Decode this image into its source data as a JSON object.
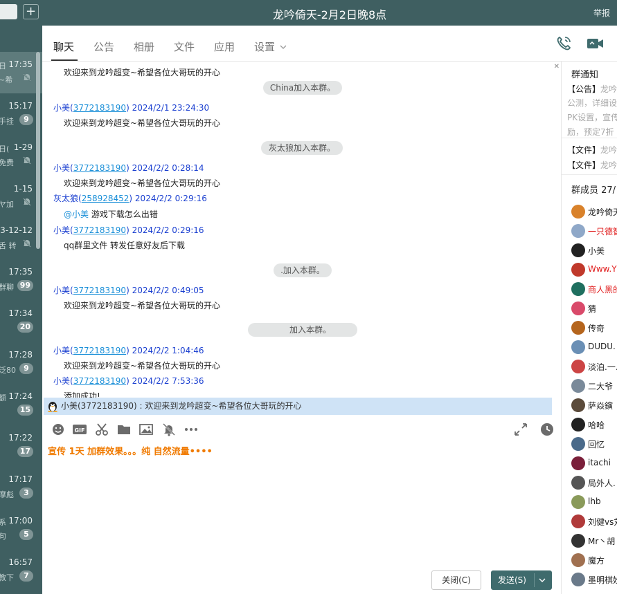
{
  "window": {
    "title": "龙吟倚天-2月2日晚8点",
    "report_label": "举报"
  },
  "sidebar": {
    "plus_label": "+",
    "items": [
      {
        "time": "17:35",
        "preview": "日",
        "preview2": "~希",
        "badge": "",
        "muted": true,
        "active": true
      },
      {
        "time": "15:17",
        "preview": "",
        "preview2": "手挂",
        "badge": "9",
        "muted": false,
        "active": false
      },
      {
        "time": "1-29",
        "preview": "日(",
        "preview2": "免费",
        "badge": "",
        "muted": true,
        "active": false
      },
      {
        "time": "1-15",
        "preview": "",
        "preview2": "ヤ加",
        "badge": "",
        "muted": true,
        "active": false
      },
      {
        "time": "3-12-12",
        "preview": "",
        "preview2": "舌 转",
        "badge": "",
        "muted": true,
        "active": false
      },
      {
        "time": "17:35",
        "preview": "",
        "preview2": "群聊",
        "badge": "99",
        "muted": false,
        "active": false
      },
      {
        "time": "17:34",
        "preview": "",
        "preview2": "",
        "badge": "20",
        "muted": false,
        "active": false
      },
      {
        "time": "17:28",
        "preview": "",
        "preview2": "泛80",
        "badge": "9",
        "muted": false,
        "active": false
      },
      {
        "time": "17:24",
        "preview": "额",
        "preview2": "",
        "badge": "15",
        "muted": false,
        "active": false
      },
      {
        "time": "17:22",
        "preview": "",
        "preview2": "",
        "badge": "17",
        "muted": false,
        "active": false
      },
      {
        "time": "17:17",
        "preview": "",
        "preview2": "摩彪",
        "badge": "3",
        "muted": false,
        "active": false
      },
      {
        "time": "17:00",
        "preview": "系",
        "preview2": "句",
        "badge": "5",
        "muted": false,
        "active": false
      },
      {
        "time": "16:57",
        "preview": "",
        "preview2": "教下",
        "badge": "7",
        "muted": false,
        "active": false
      }
    ]
  },
  "tabs": [
    {
      "label": "聊天",
      "active": true
    },
    {
      "label": "公告",
      "active": false
    },
    {
      "label": "相册",
      "active": false
    },
    {
      "label": "文件",
      "active": false
    },
    {
      "label": "应用",
      "active": false
    },
    {
      "label": "设置",
      "active": false
    }
  ],
  "chat": {
    "messages": [
      {
        "kind": "text",
        "body": "欢迎来到龙吟超变~希望各位大哥玩的开心"
      },
      {
        "kind": "system",
        "text": "China加入本群。"
      },
      {
        "kind": "msg",
        "name": "小美",
        "qq": "3772183190",
        "time": "2024/2/1 23:24:30",
        "body": "欢迎来到龙吟超变~希望各位大哥玩的开心"
      },
      {
        "kind": "system",
        "text": "灰太狼加入本群。"
      },
      {
        "kind": "msg",
        "name": "小美",
        "qq": "3772183190",
        "time": "2024/2/2 0:28:14",
        "body": "欢迎来到龙吟超变~希望各位大哥玩的开心"
      },
      {
        "kind": "msg",
        "name": "灰太狼",
        "qq": "258928452",
        "time": "2024/2/2 0:29:16",
        "at": "@小美",
        "body": "游戏下载怎么出错"
      },
      {
        "kind": "msg",
        "name": "小美",
        "qq": "3772183190",
        "time": "2024/2/2 0:29:16",
        "body": "qq群里文件 转发任意好友后下载"
      },
      {
        "kind": "system",
        "text": ".加入本群。"
      },
      {
        "kind": "msg",
        "name": "小美",
        "qq": "3772183190",
        "time": "2024/2/2 0:49:05",
        "body": "欢迎来到龙吟超变~希望各位大哥玩的开心"
      },
      {
        "kind": "system",
        "text": "加入本群。"
      },
      {
        "kind": "msg",
        "name": "小美",
        "qq": "3772183190",
        "time": "2024/2/2 1:04:46",
        "body": "欢迎来到龙吟超变~希望各位大哥玩的开心"
      },
      {
        "kind": "msg",
        "name": "小美",
        "qq": "3772183190",
        "time": "2024/2/2 7:53:36",
        "body": "添加成功!"
      }
    ],
    "quote": "小美(3772183190) : 欢迎来到龙吟超变~希望各位大哥玩的开心"
  },
  "input": {
    "text": "宣传 1天 加群效果。。。纯 自然流量••••",
    "close_label": "关闭(C)",
    "send_label": "发送(S)"
  },
  "right_panel": {
    "notice_title": "群通知",
    "notices": [
      {
        "tag": "【公告】",
        "text": "龙吟"
      },
      {
        "tag": "",
        "text": "公测，详细设"
      },
      {
        "tag": "",
        "text": "PK设置，宣传"
      },
      {
        "tag": "",
        "text": "励，预定7折"
      },
      {
        "tag": "【文件】",
        "text": "龙吟"
      },
      {
        "tag": "【文件】",
        "text": "龙吟"
      }
    ],
    "members_title": "群成员 27/",
    "members": [
      {
        "name": "龙吟倚天",
        "red": false,
        "color": "#d9822b"
      },
      {
        "name": "一只德智",
        "red": true,
        "color": "#8fa8c8"
      },
      {
        "name": "小美",
        "red": false,
        "color": "#222222"
      },
      {
        "name": "Www.Y",
        "red": true,
        "color": "#c0392b"
      },
      {
        "name": "商人黑的",
        "red": true,
        "color": "#1f6f5f"
      },
      {
        "name": "猜",
        "red": false,
        "color": "#d94a6a"
      },
      {
        "name": "传奇",
        "red": false,
        "color": "#b5651d"
      },
      {
        "name": "DUDU.",
        "red": false,
        "color": "#6a8fb5"
      },
      {
        "name": "淡泊.一.",
        "red": false,
        "color": "#c44"
      },
      {
        "name": "二大爷",
        "red": false,
        "color": "#7a8a9a"
      },
      {
        "name": "萨焱鏔",
        "red": false,
        "color": "#5a4a3a"
      },
      {
        "name": "哈哈",
        "red": false,
        "color": "#222222"
      },
      {
        "name": "回忆",
        "red": false,
        "color": "#4a6a8a"
      },
      {
        "name": "itachi",
        "red": false,
        "color": "#7a1f3a"
      },
      {
        "name": "局外人.",
        "red": false,
        "color": "#555555"
      },
      {
        "name": "lhb",
        "red": false,
        "color": "#8a9a5a"
      },
      {
        "name": "刘健vs刘",
        "red": false,
        "color": "#b03a3a"
      },
      {
        "name": "Mr丶胡",
        "red": false,
        "color": "#333333"
      },
      {
        "name": "魔方",
        "red": false,
        "color": "#a07050"
      },
      {
        "name": "墨明棋妙",
        "red": false,
        "color": "#6a7a8a"
      }
    ]
  }
}
